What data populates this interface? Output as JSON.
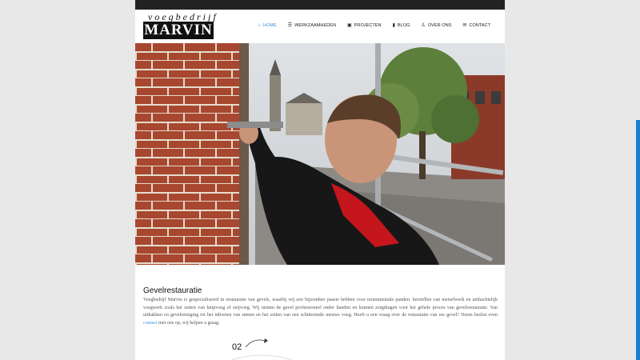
{
  "brand": {
    "top": "voegbedrijf",
    "name": "MARVIN"
  },
  "nav": {
    "items": [
      {
        "label": "HOME",
        "icon": "home-icon",
        "active": true
      },
      {
        "label": "WERKZAAMHEDEN",
        "icon": "list-icon",
        "active": false
      },
      {
        "label": "PROJECTEN",
        "icon": "camera-icon",
        "active": false
      },
      {
        "label": "BLOG",
        "icon": "book-icon",
        "active": false
      },
      {
        "label": "OVER ONS",
        "icon": "person-icon",
        "active": false
      },
      {
        "label": "CONTACT",
        "icon": "envelope-icon",
        "active": false
      }
    ]
  },
  "hero": {
    "alt": "Voeger aan het werk aan een bakstenen gevel"
  },
  "section": {
    "title": "Gevelrestauratie",
    "text_before_link": "Voegbedrijf Marvin is gespecialiseerd in restauratie van gevels, waarbij wij een bijzondere passie hebben voor monumentale panden. herstellen van metselwerk en ambachtelijk voegwerk zoals het zetten van knipvoeg of snijvoeg. Wij nemen de gevel professioneel onder handen en kunnen zorgdragen voor het gehele proces van gevelrestauratie. Van uithakken en gevelreiniging tot het inboeten van stenen en het zetten van een schitterende nieuwe voeg. Heeft u een vraag over de restauratie van uw gevel? Neem beslist even ",
    "link": "contact",
    "text_after_link": " met ons op, wij helpen u graag."
  },
  "step": {
    "number": "02"
  },
  "colors": {
    "accent": "#3b8fd9",
    "topbar": "#222222",
    "background": "#e8e8e8"
  }
}
